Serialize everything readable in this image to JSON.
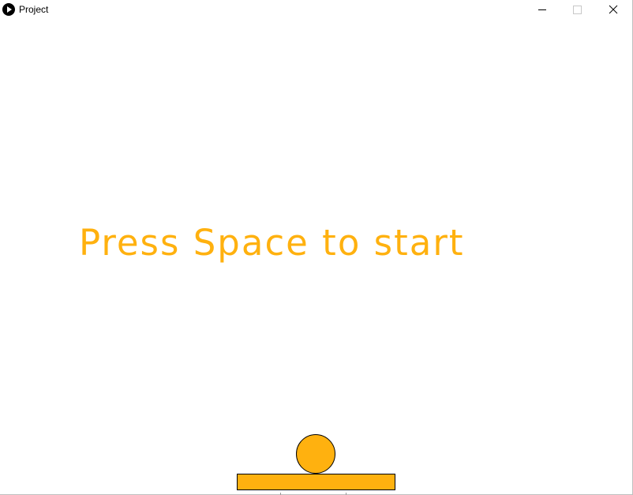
{
  "window": {
    "title": "Project",
    "app_icon": "play-icon",
    "controls": [
      "minimize-icon",
      "maximize-icon",
      "close-icon"
    ]
  },
  "game": {
    "message": "Press Space to start",
    "accent_color": "#ffb10f",
    "outline_color": "#000000",
    "background_color": "#ffffff"
  }
}
